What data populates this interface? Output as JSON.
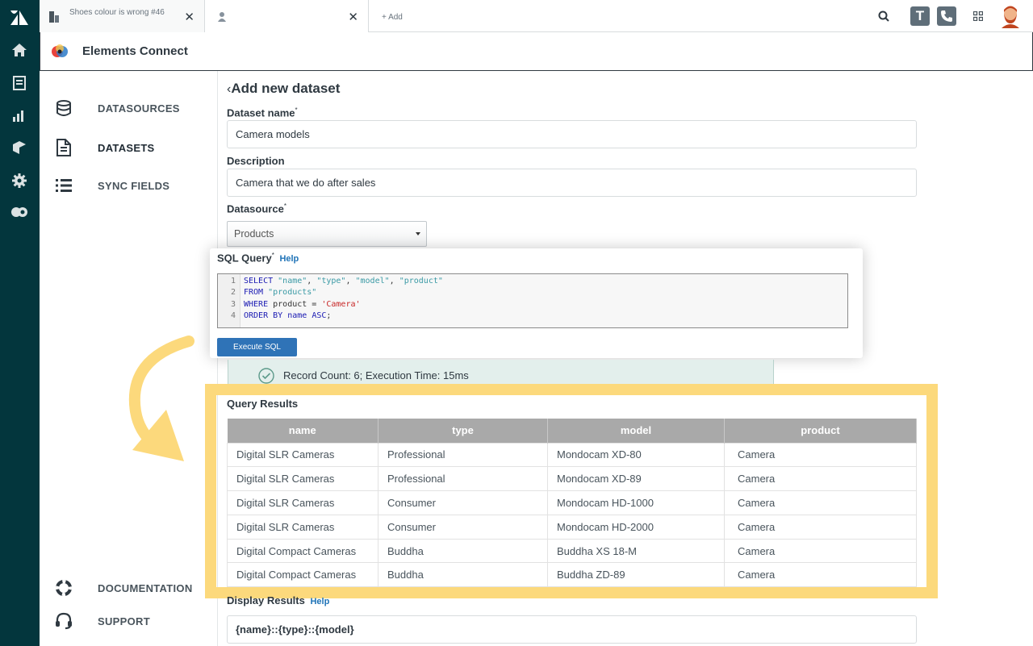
{
  "tabs": [
    {
      "title": "Shoes colour is wrong #46",
      "close": "✕"
    },
    {
      "title": "",
      "close": "✕"
    }
  ],
  "add_tab_label": "+ Add",
  "top_buttons": {
    "t_label": "T"
  },
  "app": {
    "name": "Elements Connect"
  },
  "nav": {
    "items": [
      {
        "label": "DATASOURCES",
        "icon": "database-icon"
      },
      {
        "label": "DATASETS",
        "icon": "document-icon",
        "active": true
      },
      {
        "label": "SYNC FIELDS",
        "icon": "list-icon"
      }
    ],
    "bottom": [
      {
        "label": "DOCUMENTATION",
        "icon": "lifebuoy-icon"
      },
      {
        "label": "SUPPORT",
        "icon": "headset-icon"
      }
    ]
  },
  "page": {
    "back": "‹",
    "title": "Add new dataset",
    "dataset_name_label": "Dataset name",
    "dataset_name_value": "Camera models",
    "description_label": "Description",
    "description_value": "Camera that we do after sales",
    "datasource_label": "Datasource",
    "datasource_value": "Products",
    "required_mark": "*"
  },
  "sql": {
    "label": "SQL Query",
    "help": "Help",
    "execute_label": "Execute SQL",
    "lines": [
      {
        "n": "1"
      },
      {
        "n": "2"
      },
      {
        "n": "3"
      },
      {
        "n": "4"
      }
    ]
  },
  "result": {
    "message": "Record Count: 6; Execution Time: 15ms"
  },
  "query_results": {
    "title": "Query Results",
    "columns": [
      "name",
      "type",
      "model",
      "product"
    ],
    "rows": [
      [
        "Digital SLR Cameras",
        "Professional",
        "Mondocam XD-80",
        "Camera"
      ],
      [
        "Digital SLR Cameras",
        "Professional",
        "Mondocam XD-89",
        "Camera"
      ],
      [
        "Digital SLR Cameras",
        "Consumer",
        "Mondocam HD-1000",
        "Camera"
      ],
      [
        "Digital SLR Cameras",
        "Consumer",
        "Mondocam HD-2000",
        "Camera"
      ],
      [
        "Digital Compact Cameras",
        "Buddha",
        "Buddha XS 18-M",
        "Camera"
      ],
      [
        "Digital Compact Cameras",
        "Buddha",
        "Buddha ZD-89",
        "Camera"
      ]
    ]
  },
  "display": {
    "label": "Display Results",
    "help": "Help",
    "value": "{name}::{type}::{model}"
  },
  "colors": {
    "rail": "#03363d",
    "highlight": "#fcd97c",
    "accent": "#1f73b7",
    "table_header": "#a9a9a9"
  }
}
